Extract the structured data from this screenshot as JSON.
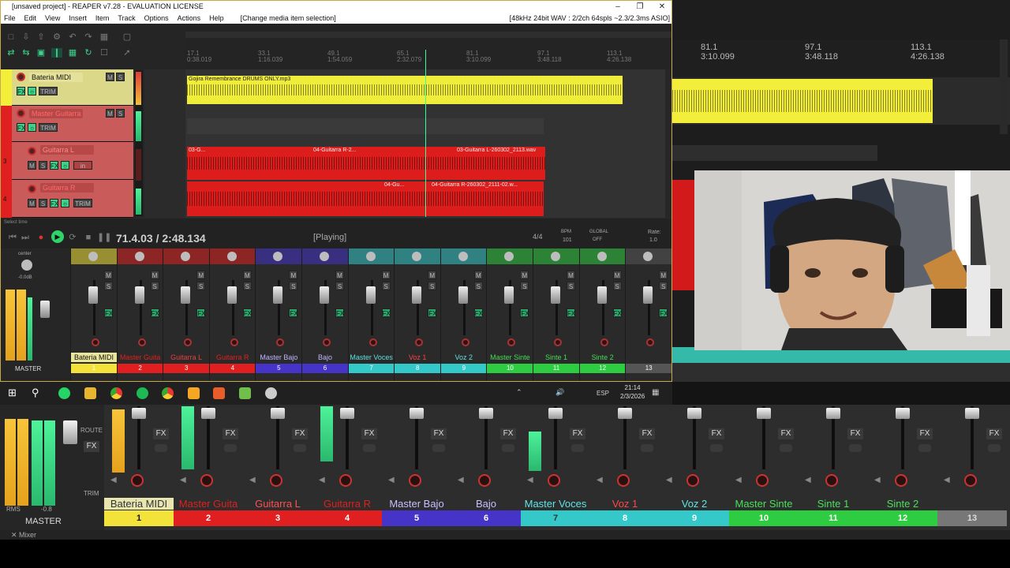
{
  "window": {
    "title": "[unsaved project] - REAPER v7.28 - EVALUATION LICENSE",
    "format": "[48kHz 24bit WAV : 2/2ch 64spls ~2.3/2.3ms ASIO]"
  },
  "menu": [
    "File",
    "Edit",
    "View",
    "Insert",
    "Item",
    "Track",
    "Options",
    "Actions",
    "Help",
    "[Change media item selection]"
  ],
  "ruler": [
    {
      "bar": "17.1",
      "time": "0:38.019"
    },
    {
      "bar": "33.1",
      "time": "1:16.039"
    },
    {
      "bar": "49.1",
      "time": "1:54.059"
    },
    {
      "bar": "65.1",
      "time": "2:32.079"
    },
    {
      "bar": "81.1",
      "time": "3:10.099"
    },
    {
      "bar": "97.1",
      "time": "3:48.118"
    },
    {
      "bar": "113.1",
      "time": "4:26.138"
    }
  ],
  "right_ruler": [
    {
      "bar": "81.1",
      "time": "3:10.099"
    },
    {
      "bar": "97.1",
      "time": "3:48.118"
    },
    {
      "bar": "113.1",
      "time": "4:26.138"
    }
  ],
  "tracks": [
    {
      "num": "1",
      "name": "Bateria MIDI",
      "color": "#e6e08a"
    },
    {
      "num": "2",
      "name": "Master Guitarra",
      "color": "#d94040"
    },
    {
      "num": "3",
      "name": "Guitarra L",
      "color": "#d94040"
    },
    {
      "num": "4",
      "name": "Guitarra R",
      "color": "#d94040"
    }
  ],
  "clips": {
    "drums": "Gojira Remembrance DRUMS ONLY.mp3",
    "gl1": "03-G...",
    "gl2": "04-Guitarra R-2...",
    "gl3": "03-Guitarra L-260302_2113.wav",
    "gr1": "04-Gu...",
    "gr2": "04-Guitarra R-260302_2111-02.w..."
  },
  "transport": {
    "position": "71.4.03 / 2:48.134",
    "state": "[Playing]",
    "timesig": "4/4",
    "bpm_label": "BPM",
    "bpm": "101",
    "global": "GLOBAL",
    "global_state": "OFF",
    "rate_label": "Rate:",
    "rate": "1.0"
  },
  "mixer": {
    "master_label": "MASTER",
    "master_pan": "center",
    "master_db": "-0.0dB",
    "channels": [
      {
        "name": "Bateria MIDI",
        "num": "1",
        "color": "#f2e23a",
        "text": "#111"
      },
      {
        "name": "Master Guita",
        "num": "2",
        "color": "#e02020",
        "text": "#e02020"
      },
      {
        "name": "Guitarra L",
        "num": "3",
        "color": "#e02020",
        "text": "#e84040"
      },
      {
        "name": "Guitarra R",
        "num": "4",
        "color": "#e02020",
        "text": "#e02020"
      },
      {
        "name": "Master Bajo",
        "num": "5",
        "color": "#4633c8",
        "text": "#bfb6ff"
      },
      {
        "name": "Bajo",
        "num": "6",
        "color": "#4633c8",
        "text": "#bfb6ff"
      },
      {
        "name": "Master Voces",
        "num": "7",
        "color": "#34c8c8",
        "text": "#5fe0e0"
      },
      {
        "name": "Voz 1",
        "num": "8",
        "color": "#34c8c8",
        "text": "#ff4040"
      },
      {
        "name": "Voz 2",
        "num": "9",
        "color": "#34c8c8",
        "text": "#5fe0e0"
      },
      {
        "name": "Master Sinte",
        "num": "10",
        "color": "#2ecc40",
        "text": "#44dd55"
      },
      {
        "name": "Sinte 1",
        "num": "11",
        "color": "#2ecc40",
        "text": "#44dd55"
      },
      {
        "name": "Sinte 2",
        "num": "12",
        "color": "#2ecc40",
        "text": "#44dd55"
      },
      {
        "name": "",
        "num": "13",
        "color": "#555",
        "text": "#aaa"
      }
    ]
  },
  "big_mixer": {
    "master_label": "MASTER",
    "master_db": "-0.8",
    "rms_label": "RMS",
    "route_label": "ROUTE",
    "trim_label": "TRIM",
    "fx_label": "FX",
    "channels": [
      {
        "name": "Bateria MIDI",
        "num": "1",
        "color": "#f2e23a",
        "text": "#ddd",
        "numtext": "#111"
      },
      {
        "name": "Master Guita",
        "num": "2",
        "color": "#e02020",
        "text": "#e02020",
        "numtext": "#fff"
      },
      {
        "name": "Guitarra L",
        "num": "3",
        "color": "#e02020",
        "text": "#ff5050",
        "numtext": "#fff"
      },
      {
        "name": "Guitarra R",
        "num": "4",
        "color": "#e02020",
        "text": "#e02020",
        "numtext": "#fff"
      },
      {
        "name": "Master Bajo",
        "num": "5",
        "color": "#4633c8",
        "text": "#c7bfff",
        "numtext": "#fff"
      },
      {
        "name": "Bajo",
        "num": "6",
        "color": "#4633c8",
        "text": "#c7bfff",
        "numtext": "#fff"
      },
      {
        "name": "Master Voces",
        "num": "7",
        "color": "#34c8c8",
        "text": "#5fe6e6",
        "numtext": "#333"
      },
      {
        "name": "Voz 1",
        "num": "8",
        "color": "#34c8c8",
        "text": "#ff4848",
        "numtext": "#fff"
      },
      {
        "name": "Voz 2",
        "num": "9",
        "color": "#34c8c8",
        "text": "#5fe6e6",
        "numtext": "#fff"
      },
      {
        "name": "Master Sinte",
        "num": "10",
        "color": "#2ecc40",
        "text": "#4ae05a",
        "numtext": "#fff"
      },
      {
        "name": "Sinte 1",
        "num": "11",
        "color": "#2ecc40",
        "text": "#4ae05a",
        "numtext": "#fff"
      },
      {
        "name": "Sinte 2",
        "num": "12",
        "color": "#2ecc40",
        "text": "#4ae05a",
        "numtext": "#fff"
      },
      {
        "name": "",
        "num": "13",
        "color": "#777",
        "text": "#aaa",
        "numtext": "#ddd"
      }
    ]
  },
  "taskbar": {
    "lang": "ESP",
    "time": "21:14",
    "date": "2/3/2026"
  },
  "mixer_tab": "Mixer",
  "selection_label": "Select time"
}
